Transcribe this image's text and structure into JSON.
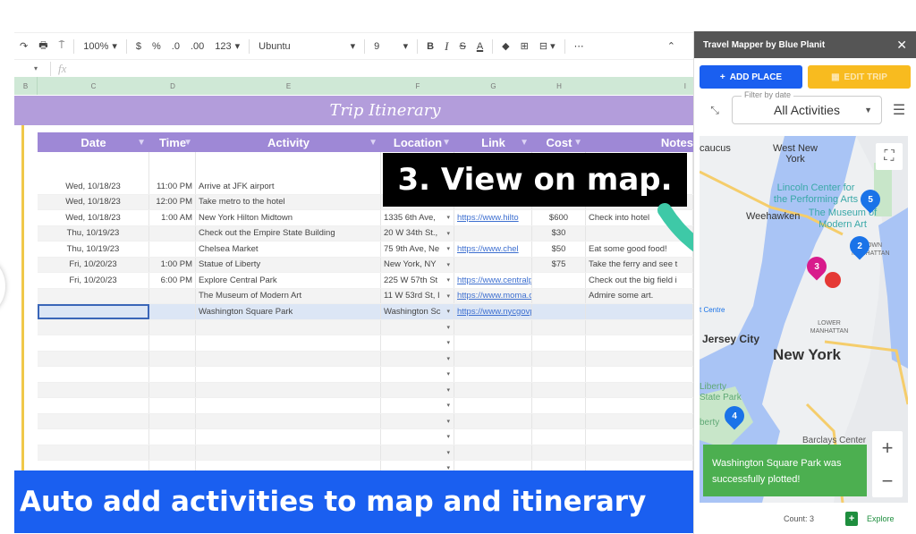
{
  "toolbar": {
    "zoom": "100%",
    "currency": "$",
    "percent": "%",
    "dec_decrease": ".0",
    "dec_increase": ".00",
    "format": "123",
    "font": "Ubuntu",
    "font_size": "9",
    "bold": "B",
    "italic": "I",
    "strike": "S",
    "text_color": "A",
    "more": "⋯",
    "collapse": "⌃"
  },
  "formula": {
    "fx": "fx"
  },
  "columns": [
    "B",
    "C",
    "D",
    "E",
    "F",
    "G",
    "H",
    "I"
  ],
  "sheet": {
    "title": "Trip Itinerary",
    "headers": [
      "Date",
      "Time",
      "Activity",
      "Location",
      "Link",
      "Cost",
      "Notes"
    ],
    "rows": [
      {
        "date": "Wed, 10/18/23",
        "time": "11:00 PM",
        "activity": "Arrive at JFK airport",
        "location": "",
        "link": "",
        "cost": "",
        "notes": ""
      },
      {
        "date": "Wed, 10/18/23",
        "time": "12:00 PM",
        "activity": "Take metro to the hotel",
        "location": "",
        "link": "",
        "cost": "",
        "notes": ""
      },
      {
        "date": "Wed, 10/18/23",
        "time": "1:00 AM",
        "activity": "New York Hilton Midtown",
        "location": "1335 6th Ave,",
        "link": "https://www.hilto",
        "cost": "$600",
        "notes": "Check into hotel"
      },
      {
        "date": "Thu, 10/19/23",
        "time": "",
        "activity": "Check out the Empire State Building",
        "location": "20 W 34th St.,",
        "link": "",
        "cost": "$30",
        "notes": ""
      },
      {
        "date": "Thu, 10/19/23",
        "time": "",
        "activity": "Chelsea Market",
        "location": "75 9th Ave, Ne",
        "link": "https://www.chel",
        "cost": "$50",
        "notes": "Eat some good food!"
      },
      {
        "date": "Fri, 10/20/23",
        "time": "1:00 PM",
        "activity": "Statue of Liberty",
        "location": "New York, NY",
        "link": "",
        "cost": "$75",
        "notes": "Take the ferry and see t"
      },
      {
        "date": "Fri, 10/20/23",
        "time": "6:00 PM",
        "activity": "Explore Central Park",
        "location": "225 W 57th St",
        "link": "https://www.centralpark.com/",
        "cost": "",
        "notes": "Check out the big field i"
      },
      {
        "date": "",
        "time": "",
        "activity": "The Museum of Modern Art",
        "location": "11 W 53rd St, I",
        "link": "https://www.moma.org/",
        "cost": "",
        "notes": "Admire some art."
      },
      {
        "date": "",
        "time": "",
        "activity": "Washington Square Park",
        "location": "Washington Sc",
        "link": "https://www.nycgovparks.org/parks/washington-square-",
        "cost": "",
        "notes": ""
      }
    ],
    "empty_rows": 10
  },
  "callout": "3. View on map.",
  "banner": "Auto add activities to map and itinerary",
  "panel": {
    "title": "Travel Mapper by Blue Planit",
    "close": "✕",
    "add_place": "ADD PLACE",
    "edit_trip": "EDIT TRIP",
    "filter_label": "Filter by date",
    "filter_value": "All Activities",
    "map_labels": {
      "secaucus": "caucus",
      "west_new_york": "West New York",
      "lincoln": "Lincoln Center for the Performing Arts",
      "weehawken": "Weehawken",
      "moma": "The Museum of Modern Art",
      "midtown": "MIDTOWN MANHATTAN",
      "jersey_city": "Jersey City",
      "new_york": "New York",
      "lower_manhattan": "LOWER MANHATTAN",
      "liberty_park": "Liberty State Park",
      "liberty": "berty",
      "centre": "t Centre",
      "barclays": "Barclays Center"
    },
    "pins": [
      {
        "label": "5",
        "color": "#1a73e8"
      },
      {
        "label": "2",
        "color": "#1a73e8"
      },
      {
        "label": "3",
        "color": "#d81b8c"
      },
      {
        "label": "4",
        "color": "#1a73e8"
      },
      {
        "label": "",
        "color": "#e53935"
      }
    ],
    "toast": "Washington Square Park was successfully plotted!",
    "count": "Count: 3",
    "explore": "Explore"
  }
}
